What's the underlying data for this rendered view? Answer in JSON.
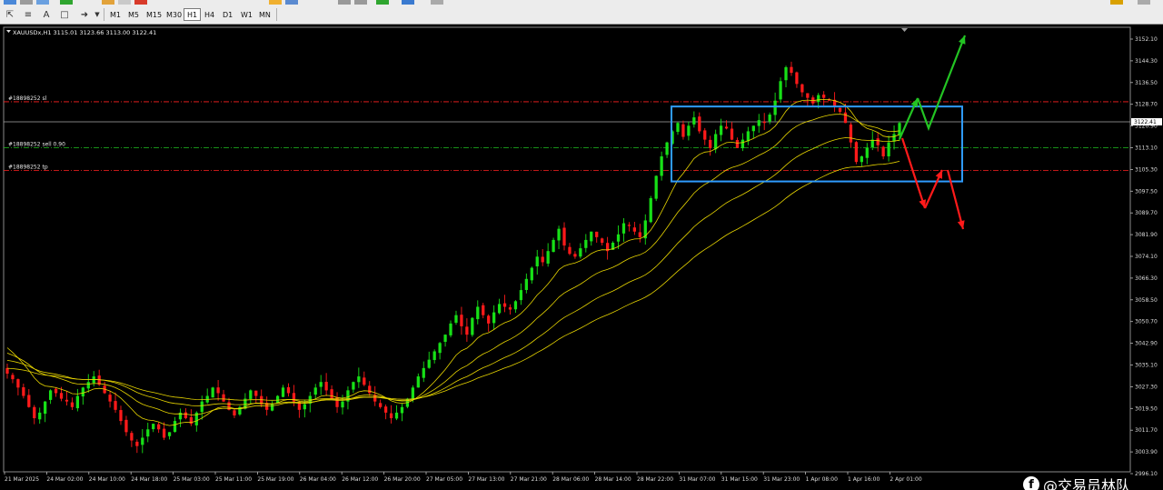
{
  "toolbar": {
    "timeframes": [
      "M1",
      "M5",
      "M15",
      "M30",
      "H1",
      "H4",
      "D1",
      "W1",
      "MN"
    ],
    "active_timeframe": "H1"
  },
  "chart_data": {
    "type": "candlestick",
    "symbol_header": "XAUUSDx,H1  3115.01 3123.66 3113.00 3122.41",
    "current_price": "3122.41",
    "y_ticks": [
      "3152.10",
      "3144.30",
      "3136.50",
      "3128.70",
      "3120.90",
      "3113.10",
      "3105.30",
      "3097.50",
      "3089.70",
      "3081.90",
      "3074.10",
      "3066.30",
      "3058.50",
      "3050.70",
      "3042.90",
      "3035.10",
      "3027.30",
      "3019.50",
      "3011.70",
      "3003.90",
      "2996.10"
    ],
    "ylim": [
      2996.1,
      3152.1
    ],
    "x_ticks": [
      "21 Mar 2025",
      "24 Mar 02:00",
      "24 Mar 10:00",
      "24 Mar 18:00",
      "25 Mar 03:00",
      "25 Mar 11:00",
      "25 Mar 19:00",
      "26 Mar 04:00",
      "26 Mar 12:00",
      "26 Mar 20:00",
      "27 Mar 05:00",
      "27 Mar 13:00",
      "27 Mar 21:00",
      "28 Mar 06:00",
      "28 Mar 14:00",
      "28 Mar 22:00",
      "31 Mar 07:00",
      "31 Mar 15:00",
      "31 Mar 23:00",
      "1 Apr 08:00",
      "1 Apr 16:00",
      "2 Apr 01:00"
    ],
    "orders": [
      {
        "label": "#18898252 sl",
        "price": 3129.6,
        "color": "#ff2020"
      },
      {
        "label": "#18898252 sell 0.90",
        "price": 3113.1,
        "color": "#20c020"
      },
      {
        "label": "#18898252 tp",
        "price": 3104.9,
        "color": "#ff2020"
      }
    ],
    "box": {
      "price_top": 3127.9,
      "price_bottom": 3101.0,
      "color": "#2f9bff"
    },
    "closes": [
      3032,
      3030,
      3027,
      3024,
      3020,
      3016,
      3018,
      3022,
      3026,
      3025,
      3023,
      3022,
      3020,
      3024,
      3027,
      3029,
      3031,
      3028,
      3025,
      3022,
      3019,
      3015,
      3011,
      3008,
      3006,
      3009,
      3012,
      3014,
      3012,
      3009,
      3011,
      3015,
      3018,
      3016,
      3014,
      3018,
      3022,
      3024,
      3027,
      3025,
      3022,
      3019,
      3017,
      3020,
      3023,
      3026,
      3024,
      3021,
      3019,
      3021,
      3024,
      3027,
      3025,
      3022,
      3019,
      3021,
      3024,
      3027,
      3029,
      3026,
      3023,
      3020,
      3022,
      3026,
      3029,
      3031,
      3028,
      3025,
      3022,
      3020,
      3018,
      3016,
      3018,
      3020,
      3023,
      3027,
      3031,
      3034,
      3037,
      3040,
      3043,
      3046,
      3050,
      3053,
      3049,
      3046,
      3052,
      3056,
      3053,
      3050,
      3054,
      3057,
      3056,
      3055,
      3058,
      3062,
      3066,
      3070,
      3074,
      3072,
      3076,
      3080,
      3084,
      3078,
      3075,
      3074,
      3077,
      3080,
      3083,
      3081,
      3079,
      3076,
      3079,
      3082,
      3086,
      3085,
      3083,
      3081,
      3087,
      3095,
      3103,
      3110,
      3115,
      3119,
      3122,
      3117,
      3121,
      3124,
      3119,
      3116,
      3113,
      3118,
      3121,
      3120,
      3116,
      3113,
      3116,
      3119,
      3121,
      3123,
      3122,
      3125,
      3130,
      3137,
      3142,
      3140,
      3136,
      3133,
      3131,
      3129,
      3132,
      3131,
      3130,
      3128,
      3126,
      3122,
      3115,
      3108,
      3110,
      3113,
      3116,
      3114,
      3110,
      3115,
      3118,
      3122
    ],
    "ma_periods": [
      12,
      24,
      40,
      60
    ]
  },
  "watermark": {
    "icon": "f",
    "text": "@交易员林队"
  },
  "colors": {
    "bull": "#17e017",
    "bear": "#ff1a1a",
    "ma": "#e6d400",
    "grid_frame": "#8a8a8a",
    "arrow_up": "#23c423",
    "arrow_down": "#ff1a1a"
  }
}
